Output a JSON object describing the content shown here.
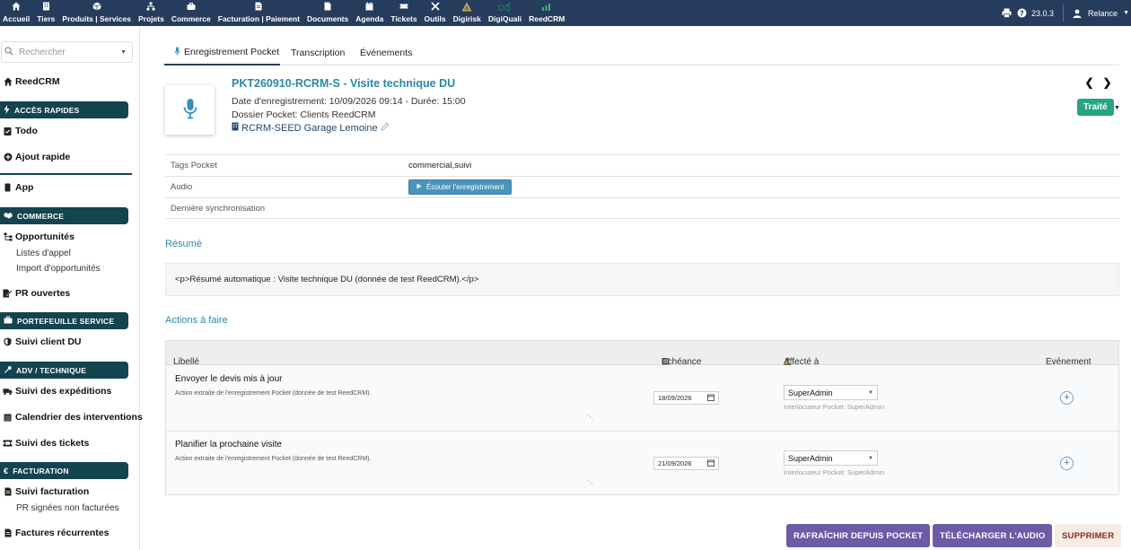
{
  "topnav": {
    "items": [
      {
        "label": "Accueil",
        "icon": "home-icon"
      },
      {
        "label": "Tiers",
        "icon": "building-icon"
      },
      {
        "label": "Produits | Services",
        "icon": "cube-icon"
      },
      {
        "label": "Projets",
        "icon": "sitemap-icon"
      },
      {
        "label": "Commerce",
        "icon": "briefcase-icon"
      },
      {
        "label": "Facturation | Paiement",
        "icon": "invoice-icon"
      },
      {
        "label": "Documents",
        "icon": "file-icon"
      },
      {
        "label": "Agenda",
        "icon": "calendar-icon"
      },
      {
        "label": "Tickets",
        "icon": "ticket-icon"
      },
      {
        "label": "Outils",
        "icon": "tools-icon"
      },
      {
        "label": "Digirisk",
        "icon": "digirisk-logo-icon"
      },
      {
        "label": "DigiQuali",
        "icon": "digiquali-logo-icon"
      },
      {
        "label": "ReedCRM",
        "icon": "reedcrm-logo-icon"
      }
    ],
    "version": "23.0.3",
    "user": "Relance"
  },
  "sidebar": {
    "search_placeholder": "Rechercher",
    "home": "ReedCRM",
    "quick_access": "ACCÈS RAPIDES",
    "todo": "Todo",
    "quick_add": "Ajout rapide",
    "app": "App",
    "commerce": "COMMERCE",
    "opportunities": "Opportunités",
    "call_lists": "Listes d'appel",
    "import_opps": "Import d'opportunités",
    "pr_open": "PR ouvertes",
    "service_portfolio": "PORTEFEUILLE SERVICE",
    "du_followup": "Suivi client DU",
    "adv_tech": "ADV / TECHNIQUE",
    "shipments": "Suivi des expéditions",
    "interventions": "Calendrier des interventions",
    "tickets": "Suivi des tickets",
    "billing": "FACTURATION",
    "billing_followup": "Suivi facturation",
    "pr_signed": "PR signées non facturées",
    "recurring": "Factures récurrentes"
  },
  "tabs": [
    "Enregistrement Pocket",
    "Transcription",
    "Événements"
  ],
  "record": {
    "title": "PKT260910-RCRM-S - Visite technique DU",
    "date_line": "Date d'enregistrement: 10/09/2026 09:14 - Durée: 15:00",
    "folder_line": "Dossier Pocket: Clients ReedCRM",
    "thirdparty": "RCRM-SEED Garage Lemoine",
    "status": "Traité"
  },
  "fields": [
    {
      "label": "Tags Pocket",
      "value": "commercial,suivi"
    },
    {
      "label": "Audio",
      "button": "Écouter l'enregistrement"
    },
    {
      "label": "Dernière synchronisation",
      "value": ""
    }
  ],
  "summary": {
    "title": "Résumé",
    "text": "<p>Résumé automatique : Visite technique DU (donnée de test ReedCRM).</p>"
  },
  "actions": {
    "title": "Actions à faire",
    "columns": {
      "label": "Libellé",
      "due": "Echéance",
      "assigned": "Affecté à",
      "event": "Evénement"
    },
    "rows": [
      {
        "label": "Envoyer le devis mis à jour",
        "desc": "Action extraite de l'enregistrement Pocket (donnée de test ReedCRM).",
        "due": "18/09/2026",
        "user": "SuperAdmin",
        "hint": "Interlocuteur Pocket: SuperAdmin"
      },
      {
        "label": "Planifier la prochaine visite",
        "desc": "Action extraite de l'enregistrement Pocket (donnée de test ReedCRM).",
        "due": "21/09/2026",
        "user": "SuperAdmin",
        "hint": "Interlocuteur Pocket: SuperAdmin"
      }
    ]
  },
  "buttons": {
    "refresh": "RAFRAÎCHIR DEPUIS POCKET",
    "download": "TÉLÉCHARGER L'AUDIO",
    "delete": "SUPPRIMER"
  },
  "colors": {
    "topbar": "#263c5c",
    "sidebar_header": "#13444f",
    "accent_link": "#2a89a3",
    "status_green": "#25a580",
    "button_purple": "#6b5ca5"
  }
}
